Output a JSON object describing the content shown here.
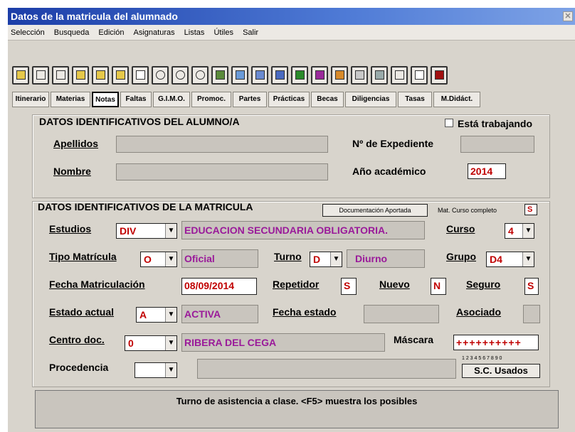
{
  "window": {
    "title": "Datos de la matricula del alumnado",
    "close_icon": "close-icon"
  },
  "menu": [
    "Selección",
    "Busqueda",
    "Edición",
    "Asignaturas",
    "Listas",
    "Útiles",
    "Salir"
  ],
  "toolbar_icons": [
    "folder-icon",
    "prev-icon",
    "next-icon",
    "add-icon",
    "edit-icon",
    "copy-icon",
    "new-page-icon",
    "search-icon",
    "search-icon",
    "search-icon",
    "key-icon",
    "view-icon",
    "chart-icon",
    "list-icon",
    "books-icon",
    "books-icon",
    "people-icon",
    "print-icon",
    "tool-icon",
    "sum-icon",
    "document-icon",
    "exit-icon"
  ],
  "tabs": [
    "Itinerario",
    "Materias",
    "Notas",
    "Faltas",
    "G.I.M.O.",
    "Promoc.",
    "Partes",
    "Prácticas",
    "Becas",
    "Diligencias",
    "Tasas",
    "M.Didáct."
  ],
  "student": {
    "title": "DATOS IDENTIFICATIVOS DEL ALUMNO/A",
    "working": "Está trabajando",
    "apellidos": "Apellidos",
    "nombre": "Nombre",
    "expediente": "Nº de Expediente",
    "anio": "Año académico",
    "anio_value": "2014"
  },
  "enrollment": {
    "title": "DATOS IDENTIFICATIVOS DE LA MATRICULA",
    "doc_btn": "Documentación Aportada",
    "mat_curso": "Mat. Curso completo",
    "mat_curso_value": "S",
    "estudios": "Estudios",
    "estudios_code": "DIV",
    "estudios_desc": "EDUCACION SECUNDARIA OBLIGATORIA.",
    "curso": "Curso",
    "curso_value": "4",
    "tipo": "Tipo Matrícula",
    "tipo_code": "O",
    "tipo_desc": "Oficial",
    "turno": "Turno",
    "turno_code": "D",
    "turno_desc": "Diurno",
    "grupo": "Grupo",
    "grupo_value": "D4",
    "fecha_mat": "Fecha  Matriculación",
    "fecha_mat_value": "08/09/2014",
    "repetidor": "Repetidor",
    "repetidor_value": "S",
    "nuevo": "Nuevo",
    "nuevo_value": "N",
    "seguro": "Seguro",
    "seguro_value": "S",
    "estado": "Estado actual",
    "estado_code": "A",
    "estado_desc": "ACTIVA",
    "fecha_estado": "Fecha estado",
    "asociado": "Asociado",
    "centro": "Centro doc.",
    "centro_code": "0",
    "centro_desc": "RIBERA DEL CEGA",
    "mascara": "Máscara",
    "mascara_value": "++++++++++",
    "procedencia": "Procedencia",
    "sc_digits": "1 2 3 4 5 6 7 8 9 0",
    "sc_btn": "S.C. Usados"
  },
  "status": "Turno de asistencia a clase. <F5> muestra los posibles"
}
